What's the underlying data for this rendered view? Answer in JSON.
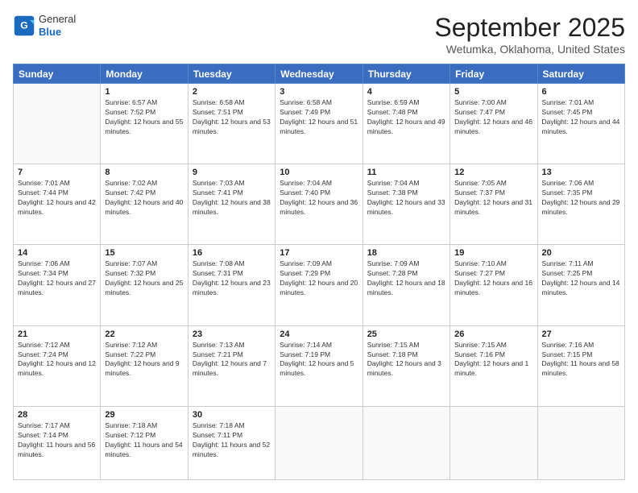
{
  "header": {
    "logo": {
      "general": "General",
      "blue": "Blue"
    },
    "title": "September 2025",
    "location": "Wetumka, Oklahoma, United States"
  },
  "weekdays": [
    "Sunday",
    "Monday",
    "Tuesday",
    "Wednesday",
    "Thursday",
    "Friday",
    "Saturday"
  ],
  "weeks": [
    [
      null,
      {
        "num": "1",
        "sunrise": "Sunrise: 6:57 AM",
        "sunset": "Sunset: 7:52 PM",
        "daylight": "Daylight: 12 hours and 55 minutes."
      },
      {
        "num": "2",
        "sunrise": "Sunrise: 6:58 AM",
        "sunset": "Sunset: 7:51 PM",
        "daylight": "Daylight: 12 hours and 53 minutes."
      },
      {
        "num": "3",
        "sunrise": "Sunrise: 6:58 AM",
        "sunset": "Sunset: 7:49 PM",
        "daylight": "Daylight: 12 hours and 51 minutes."
      },
      {
        "num": "4",
        "sunrise": "Sunrise: 6:59 AM",
        "sunset": "Sunset: 7:48 PM",
        "daylight": "Daylight: 12 hours and 49 minutes."
      },
      {
        "num": "5",
        "sunrise": "Sunrise: 7:00 AM",
        "sunset": "Sunset: 7:47 PM",
        "daylight": "Daylight: 12 hours and 46 minutes."
      },
      {
        "num": "6",
        "sunrise": "Sunrise: 7:01 AM",
        "sunset": "Sunset: 7:45 PM",
        "daylight": "Daylight: 12 hours and 44 minutes."
      }
    ],
    [
      {
        "num": "7",
        "sunrise": "Sunrise: 7:01 AM",
        "sunset": "Sunset: 7:44 PM",
        "daylight": "Daylight: 12 hours and 42 minutes."
      },
      {
        "num": "8",
        "sunrise": "Sunrise: 7:02 AM",
        "sunset": "Sunset: 7:42 PM",
        "daylight": "Daylight: 12 hours and 40 minutes."
      },
      {
        "num": "9",
        "sunrise": "Sunrise: 7:03 AM",
        "sunset": "Sunset: 7:41 PM",
        "daylight": "Daylight: 12 hours and 38 minutes."
      },
      {
        "num": "10",
        "sunrise": "Sunrise: 7:04 AM",
        "sunset": "Sunset: 7:40 PM",
        "daylight": "Daylight: 12 hours and 36 minutes."
      },
      {
        "num": "11",
        "sunrise": "Sunrise: 7:04 AM",
        "sunset": "Sunset: 7:38 PM",
        "daylight": "Daylight: 12 hours and 33 minutes."
      },
      {
        "num": "12",
        "sunrise": "Sunrise: 7:05 AM",
        "sunset": "Sunset: 7:37 PM",
        "daylight": "Daylight: 12 hours and 31 minutes."
      },
      {
        "num": "13",
        "sunrise": "Sunrise: 7:06 AM",
        "sunset": "Sunset: 7:35 PM",
        "daylight": "Daylight: 12 hours and 29 minutes."
      }
    ],
    [
      {
        "num": "14",
        "sunrise": "Sunrise: 7:06 AM",
        "sunset": "Sunset: 7:34 PM",
        "daylight": "Daylight: 12 hours and 27 minutes."
      },
      {
        "num": "15",
        "sunrise": "Sunrise: 7:07 AM",
        "sunset": "Sunset: 7:32 PM",
        "daylight": "Daylight: 12 hours and 25 minutes."
      },
      {
        "num": "16",
        "sunrise": "Sunrise: 7:08 AM",
        "sunset": "Sunset: 7:31 PM",
        "daylight": "Daylight: 12 hours and 23 minutes."
      },
      {
        "num": "17",
        "sunrise": "Sunrise: 7:09 AM",
        "sunset": "Sunset: 7:29 PM",
        "daylight": "Daylight: 12 hours and 20 minutes."
      },
      {
        "num": "18",
        "sunrise": "Sunrise: 7:09 AM",
        "sunset": "Sunset: 7:28 PM",
        "daylight": "Daylight: 12 hours and 18 minutes."
      },
      {
        "num": "19",
        "sunrise": "Sunrise: 7:10 AM",
        "sunset": "Sunset: 7:27 PM",
        "daylight": "Daylight: 12 hours and 16 minutes."
      },
      {
        "num": "20",
        "sunrise": "Sunrise: 7:11 AM",
        "sunset": "Sunset: 7:25 PM",
        "daylight": "Daylight: 12 hours and 14 minutes."
      }
    ],
    [
      {
        "num": "21",
        "sunrise": "Sunrise: 7:12 AM",
        "sunset": "Sunset: 7:24 PM",
        "daylight": "Daylight: 12 hours and 12 minutes."
      },
      {
        "num": "22",
        "sunrise": "Sunrise: 7:12 AM",
        "sunset": "Sunset: 7:22 PM",
        "daylight": "Daylight: 12 hours and 9 minutes."
      },
      {
        "num": "23",
        "sunrise": "Sunrise: 7:13 AM",
        "sunset": "Sunset: 7:21 PM",
        "daylight": "Daylight: 12 hours and 7 minutes."
      },
      {
        "num": "24",
        "sunrise": "Sunrise: 7:14 AM",
        "sunset": "Sunset: 7:19 PM",
        "daylight": "Daylight: 12 hours and 5 minutes."
      },
      {
        "num": "25",
        "sunrise": "Sunrise: 7:15 AM",
        "sunset": "Sunset: 7:18 PM",
        "daylight": "Daylight: 12 hours and 3 minutes."
      },
      {
        "num": "26",
        "sunrise": "Sunrise: 7:15 AM",
        "sunset": "Sunset: 7:16 PM",
        "daylight": "Daylight: 12 hours and 1 minute."
      },
      {
        "num": "27",
        "sunrise": "Sunrise: 7:16 AM",
        "sunset": "Sunset: 7:15 PM",
        "daylight": "Daylight: 11 hours and 58 minutes."
      }
    ],
    [
      {
        "num": "28",
        "sunrise": "Sunrise: 7:17 AM",
        "sunset": "Sunset: 7:14 PM",
        "daylight": "Daylight: 11 hours and 56 minutes."
      },
      {
        "num": "29",
        "sunrise": "Sunrise: 7:18 AM",
        "sunset": "Sunset: 7:12 PM",
        "daylight": "Daylight: 11 hours and 54 minutes."
      },
      {
        "num": "30",
        "sunrise": "Sunrise: 7:18 AM",
        "sunset": "Sunset: 7:11 PM",
        "daylight": "Daylight: 11 hours and 52 minutes."
      },
      null,
      null,
      null,
      null
    ]
  ]
}
